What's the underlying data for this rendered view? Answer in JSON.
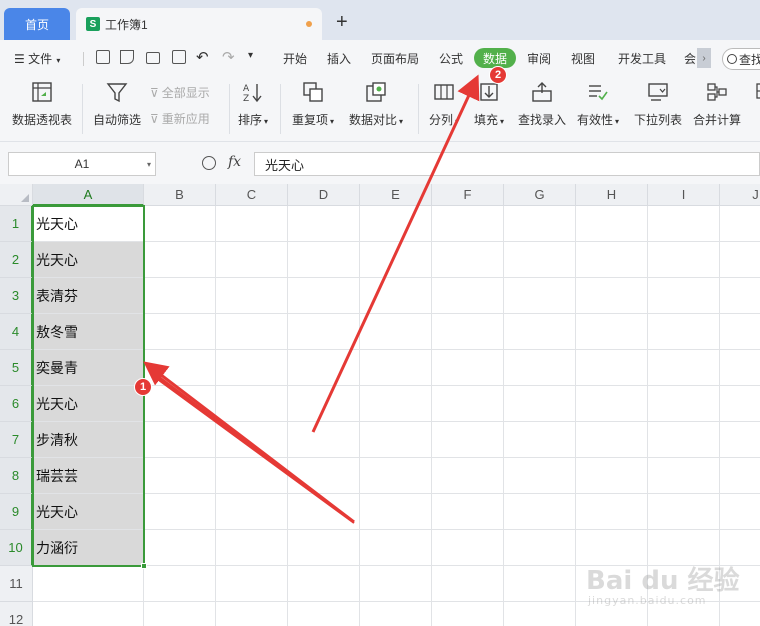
{
  "tabs": {
    "home": "首页",
    "doc_icon": "S",
    "doc_title": "工作簿1",
    "add": "+"
  },
  "menu": {
    "file": "文件",
    "items": [
      "开始",
      "插入",
      "页面布局",
      "公式",
      "数据",
      "审阅",
      "视图",
      "开发工具",
      "会"
    ],
    "active": "数据",
    "search": "查找",
    "more": "›"
  },
  "ribbon": {
    "pivot": "数据透视表",
    "autofilter": "自动筛选",
    "show_all": "全部显示",
    "reapply": "重新应用",
    "sort": "排序",
    "duplicates": "重复项",
    "compare": "数据对比",
    "split": "分列",
    "fill": "填充",
    "lookup_entry": "查找录入",
    "validity": "有效性",
    "dropdown_list": "下拉列表",
    "consolidate": "合并计算"
  },
  "formula_bar": {
    "cell_ref": "A1",
    "fx": "fx",
    "value": "光天心"
  },
  "columns": [
    "A",
    "B",
    "C",
    "D",
    "E",
    "F",
    "G",
    "H",
    "I",
    "J"
  ],
  "rows": [
    "1",
    "2",
    "3",
    "4",
    "5",
    "6",
    "7",
    "8",
    "9",
    "10",
    "11",
    "12"
  ],
  "cells_A": [
    "光天心",
    "光天心",
    "表清芬",
    "敖冬雪",
    "奕曼青",
    "光天心",
    "步清秋",
    "瑞芸芸",
    "光天心",
    "力涵衍"
  ],
  "annotations": {
    "badge1": "1",
    "badge2": "2",
    "arrow_color": "#e53935"
  },
  "watermark": {
    "brand": "Bai du 经验",
    "url": "jingyan.baidu.com"
  },
  "colors": {
    "accent_green": "#52b04b",
    "selection_border": "#3a9a3a",
    "home_tab": "#4a86e8"
  }
}
